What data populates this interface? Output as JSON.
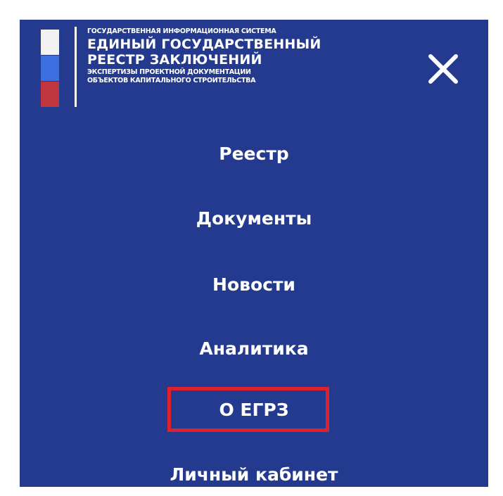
{
  "logo": {
    "line1": "ГОСУДАРСТВЕННАЯ ИНФОРМАЦИОННАЯ СИСТЕМА",
    "line2": "ЕДИНЫЙ ГОСУДАРСТВЕННЫЙ",
    "line3": "РЕЕСТР ЗАКЛЮЧЕНИЙ",
    "line4": "ЭКСПЕРТИЗЫ ПРОЕКТНОЙ ДОКУМЕНТАЦИИ",
    "line5": "ОБЪЕКТОВ КАПИТАЛЬНОГО СТРОИТЕЛЬСТВА",
    "flag_colors": [
      "#f2f2f2",
      "#3d6fe0",
      "#c0363f"
    ]
  },
  "close_icon": "close-icon",
  "menu": {
    "items": [
      {
        "label": "Реестр"
      },
      {
        "label": "Документы"
      },
      {
        "label": "Новости"
      },
      {
        "label": "Аналитика"
      },
      {
        "label": "О ЕГРЗ"
      },
      {
        "label": "Личный кабинет"
      }
    ]
  },
  "colors": {
    "panel_background": "#233a8f",
    "text": "#ffffff",
    "highlight_border": "#e0202a"
  }
}
